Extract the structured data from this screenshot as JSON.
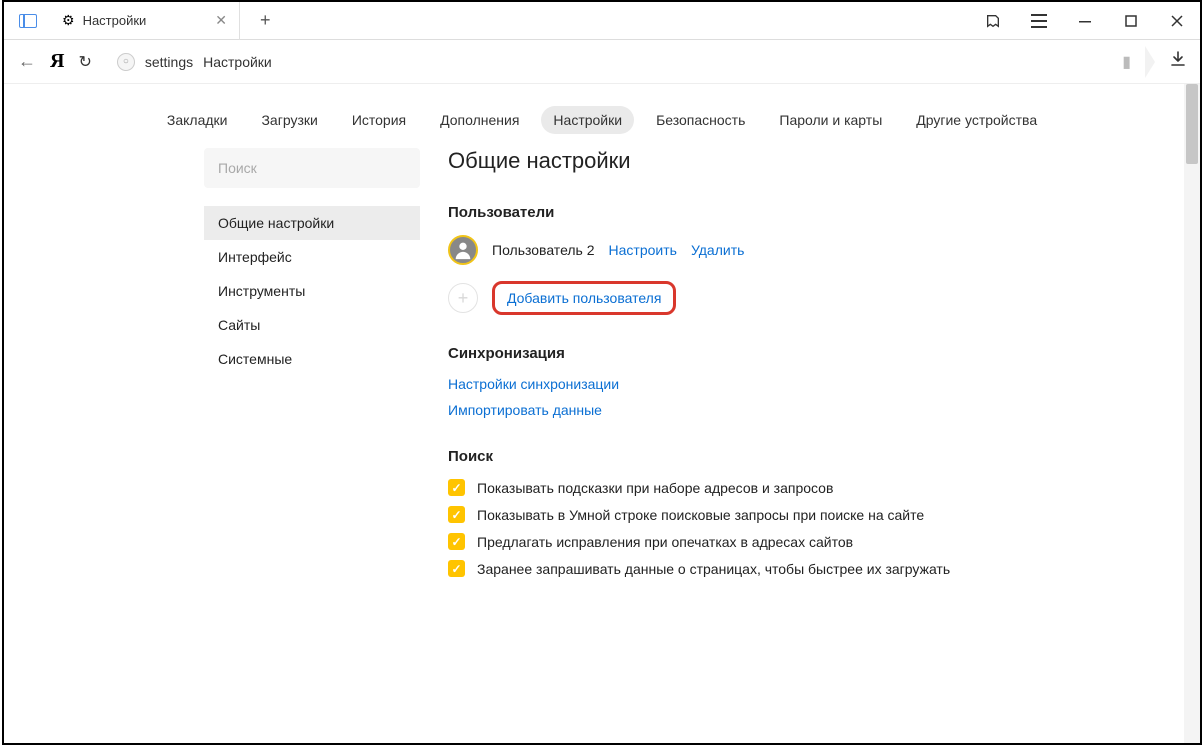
{
  "window": {
    "tab_title": "Настройки",
    "newtab_tooltip": "+"
  },
  "address": {
    "part1": "settings",
    "part2": "Настройки"
  },
  "topnav": {
    "items": [
      "Закладки",
      "Загрузки",
      "История",
      "Дополнения",
      "Настройки",
      "Безопасность",
      "Пароли и карты",
      "Другие устройства"
    ],
    "active_index": 4
  },
  "sidebar": {
    "search_placeholder": "Поиск",
    "items": [
      "Общие настройки",
      "Интерфейс",
      "Инструменты",
      "Сайты",
      "Системные"
    ],
    "active_index": 0
  },
  "main": {
    "heading": "Общие настройки",
    "users_section": "Пользователи",
    "user_name": "Пользователь 2",
    "configure": "Настроить",
    "delete": "Удалить",
    "add_user": "Добавить пользователя",
    "sync_section": "Синхронизация",
    "sync_settings": "Настройки синхронизации",
    "import_data": "Импортировать данные",
    "search_section": "Поиск",
    "checks": [
      "Показывать подсказки при наборе адресов и запросов",
      "Показывать в Умной строке поисковые запросы при поиске на сайте",
      "Предлагать исправления при опечатках в адресах сайтов",
      "Заранее запрашивать данные о страницах, чтобы быстрее их загружать"
    ]
  }
}
